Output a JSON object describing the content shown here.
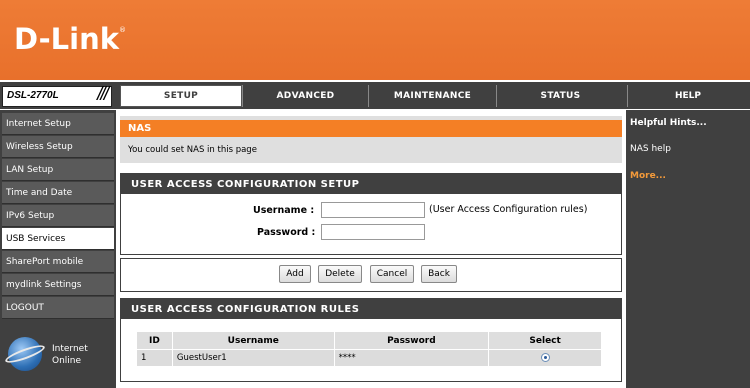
{
  "brand": {
    "logo": "D-Link",
    "trademark": "®",
    "model": "DSL-2770L",
    "model_slashes": "///"
  },
  "tabs": [
    {
      "label": "SETUP",
      "active": true
    },
    {
      "label": "ADVANCED",
      "active": false
    },
    {
      "label": "MAINTENANCE",
      "active": false
    },
    {
      "label": "STATUS",
      "active": false
    }
  ],
  "help_tab": "HELP",
  "sidebar": {
    "items": [
      {
        "label": "Internet Setup",
        "active": false
      },
      {
        "label": "Wireless Setup",
        "active": false
      },
      {
        "label": "LAN Setup",
        "active": false
      },
      {
        "label": "Time and Date",
        "active": false
      },
      {
        "label": "IPv6 Setup",
        "active": false
      },
      {
        "label": "USB Services",
        "active": true
      },
      {
        "label": "SharePort mobile",
        "active": false
      },
      {
        "label": "mydlink Settings",
        "active": false
      },
      {
        "label": "LOGOUT",
        "active": false
      }
    ],
    "status_line1": "Internet",
    "status_line2": "Online"
  },
  "nas": {
    "title": "NAS",
    "description": "You could set NAS in this page"
  },
  "setup": {
    "title": "USER ACCESS CONFIGURATION SETUP",
    "username_label": "Username :",
    "password_label": "Password :",
    "username_value": "",
    "password_value": "",
    "hint": "(User Access Configuration rules)"
  },
  "buttons": {
    "add": "Add",
    "delete": "Delete",
    "cancel": "Cancel",
    "back": "Back"
  },
  "rules": {
    "title": "USER ACCESS CONFIGURATION RULES",
    "headers": {
      "id": "ID",
      "username": "Username",
      "password": "Password",
      "select": "Select"
    },
    "rows": [
      {
        "id": "1",
        "username": "GuestUser1",
        "password": "****",
        "selected": true
      }
    ]
  },
  "help": {
    "title": "Helpful Hints...",
    "link": "NAS help",
    "more": "More..."
  },
  "colors": {
    "header_orange": "#ed7d31",
    "dark_gray": "#404040",
    "accent_orange": "#f47f25"
  }
}
